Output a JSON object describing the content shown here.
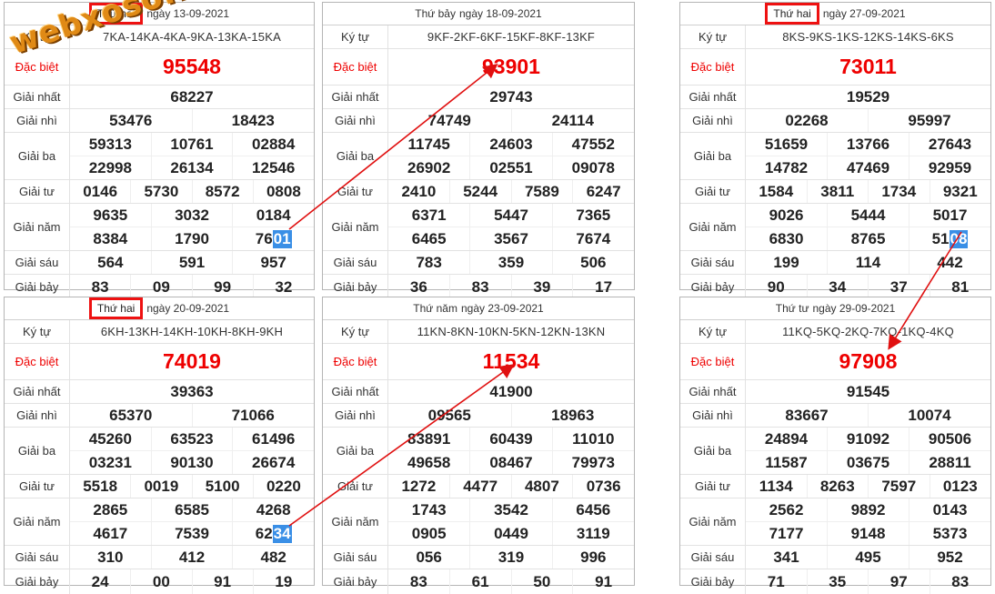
{
  "watermark": "webxoso.net",
  "tickets": [
    {
      "day": "Thứ hai",
      "date": "ngày 13-09-2021",
      "boxed": true,
      "labels": {
        "kytu": "Ký tự",
        "db": "Đặc biệt",
        "g1": "Giải nhất",
        "g2": "Giải nhì",
        "g3": "Giải ba",
        "g4": "Giải tư",
        "g5": "Giải năm",
        "g6": "Giải sáu",
        "g7": "Giải bảy"
      },
      "kytu": "7KA-14KA-4KA-9KA-13KA-15KA",
      "db": "95548",
      "g1": "68227",
      "g2": [
        "53476",
        "18423"
      ],
      "g3": [
        [
          "59313",
          "10761",
          "02884"
        ],
        [
          "22998",
          "26134",
          "12546"
        ]
      ],
      "g4": [
        "0146",
        "5730",
        "8572",
        "0808"
      ],
      "g5": [
        [
          "9635",
          "3032",
          "0184"
        ],
        [
          "8384",
          "1790",
          "7601"
        ]
      ],
      "g6": [
        "564",
        "591",
        "957"
      ],
      "g7": [
        "83",
        "09",
        "99",
        "32"
      ]
    },
    {
      "day": "Thứ bảy",
      "date": "ngày 18-09-2021",
      "boxed": false,
      "labels": {
        "kytu": "Ký tự",
        "db": "Đặc biệt",
        "g1": "Giải nhất",
        "g2": "Giải nhì",
        "g3": "Giải ba",
        "g4": "Giải tư",
        "g5": "Giải năm",
        "g6": "Giải sáu",
        "g7": "Giải bảy"
      },
      "kytu": "9KF-2KF-6KF-15KF-8KF-13KF",
      "db": "93901",
      "g1": "29743",
      "g2": [
        "74749",
        "24114"
      ],
      "g3": [
        [
          "11745",
          "24603",
          "47552"
        ],
        [
          "26902",
          "02551",
          "09078"
        ]
      ],
      "g4": [
        "2410",
        "5244",
        "7589",
        "6247"
      ],
      "g5": [
        [
          "6371",
          "5447",
          "7365"
        ],
        [
          "6465",
          "3567",
          "7674"
        ]
      ],
      "g6": [
        "783",
        "359",
        "506"
      ],
      "g7": [
        "36",
        "83",
        "39",
        "17"
      ]
    },
    {
      "day": "Thứ hai",
      "date": "ngày 27-09-2021",
      "boxed": true,
      "labels": {
        "kytu": "Ký tự",
        "db": "Đặc biệt",
        "g1": "Giải nhất",
        "g2": "Giải nhì",
        "g3": "Giải ba",
        "g4": "Giải tư",
        "g5": "Giải năm",
        "g6": "Giải sáu",
        "g7": "Giải bảy"
      },
      "kytu": "8KS-9KS-1KS-12KS-14KS-6KS",
      "db": "73011",
      "g1": "19529",
      "g2": [
        "02268",
        "95997"
      ],
      "g3": [
        [
          "51659",
          "13766",
          "27643"
        ],
        [
          "14782",
          "47469",
          "92959"
        ]
      ],
      "g4": [
        "1584",
        "3811",
        "1734",
        "9321"
      ],
      "g5": [
        [
          "9026",
          "5444",
          "5017"
        ],
        [
          "6830",
          "8765",
          "5108"
        ]
      ],
      "g6": [
        "199",
        "114",
        "442"
      ],
      "g7": [
        "90",
        "34",
        "37",
        "81"
      ]
    },
    {
      "day": "Thứ hai",
      "date": "ngày 20-09-2021",
      "boxed": true,
      "labels": {
        "kytu": "Ký tự",
        "db": "Đặc biệt",
        "g1": "Giải nhất",
        "g2": "Giải nhì",
        "g3": "Giải ba",
        "g4": "Giải tư",
        "g5": "Giải năm",
        "g6": "Giải sáu",
        "g7": "Giải bảy"
      },
      "kytu": "6KH-13KH-14KH-10KH-8KH-9KH",
      "db": "74019",
      "g1": "39363",
      "g2": [
        "65370",
        "71066"
      ],
      "g3": [
        [
          "45260",
          "63523",
          "61496"
        ],
        [
          "03231",
          "90130",
          "26674"
        ]
      ],
      "g4": [
        "5518",
        "0019",
        "5100",
        "0220"
      ],
      "g5": [
        [
          "2865",
          "6585",
          "4268"
        ],
        [
          "4617",
          "7539",
          "6234"
        ]
      ],
      "g6": [
        "310",
        "412",
        "482"
      ],
      "g7": [
        "24",
        "00",
        "91",
        "19"
      ]
    },
    {
      "day": "Thứ năm",
      "date": "ngày 23-09-2021",
      "boxed": false,
      "labels": {
        "kytu": "Ký tự",
        "db": "Đặc biệt",
        "g1": "Giải nhất",
        "g2": "Giải nhì",
        "g3": "Giải ba",
        "g4": "Giải tư",
        "g5": "Giải năm",
        "g6": "Giải sáu",
        "g7": "Giải bảy"
      },
      "kytu": "11KN-8KN-10KN-5KN-12KN-13KN",
      "db": "11534",
      "g1": "41900",
      "g2": [
        "09565",
        "18963"
      ],
      "g3": [
        [
          "83891",
          "60439",
          "11010"
        ],
        [
          "49658",
          "08467",
          "79973"
        ]
      ],
      "g4": [
        "1272",
        "4477",
        "4807",
        "0736"
      ],
      "g5": [
        [
          "1743",
          "3542",
          "6456"
        ],
        [
          "0905",
          "0449",
          "3119"
        ]
      ],
      "g6": [
        "056",
        "319",
        "996"
      ],
      "g7": [
        "83",
        "61",
        "50",
        "91"
      ]
    },
    {
      "day": "Thứ tư",
      "date": "ngày 29-09-2021",
      "boxed": false,
      "labels": {
        "kytu": "Ký tự",
        "db": "Đặc biệt",
        "g1": "Giải nhất",
        "g2": "Giải nhì",
        "g3": "Giải ba",
        "g4": "Giải tư",
        "g5": "Giải năm",
        "g6": "Giải sáu",
        "g7": "Giải bảy"
      },
      "kytu": "11KQ-5KQ-2KQ-7KQ-1KQ-4KQ",
      "db": "97908",
      "g1": "91545",
      "g2": [
        "83667",
        "10074"
      ],
      "g3": [
        [
          "24894",
          "91092",
          "90506"
        ],
        [
          "11587",
          "03675",
          "28811"
        ]
      ],
      "g4": [
        "1134",
        "8263",
        "7597",
        "0123"
      ],
      "g5": [
        [
          "2562",
          "9892",
          "0143"
        ],
        [
          "7177",
          "9148",
          "5373"
        ]
      ],
      "g6": [
        "341",
        "495",
        "952"
      ],
      "g7": [
        "71",
        "35",
        "97",
        "83"
      ]
    }
  ],
  "highlights": {
    "t0": "01",
    "t2": "08",
    "t3": "34"
  },
  "colors": {
    "arrow": "#e01010",
    "highlight": "#3a8fe6",
    "special": "#e00000",
    "watermark": "#e08a16"
  }
}
